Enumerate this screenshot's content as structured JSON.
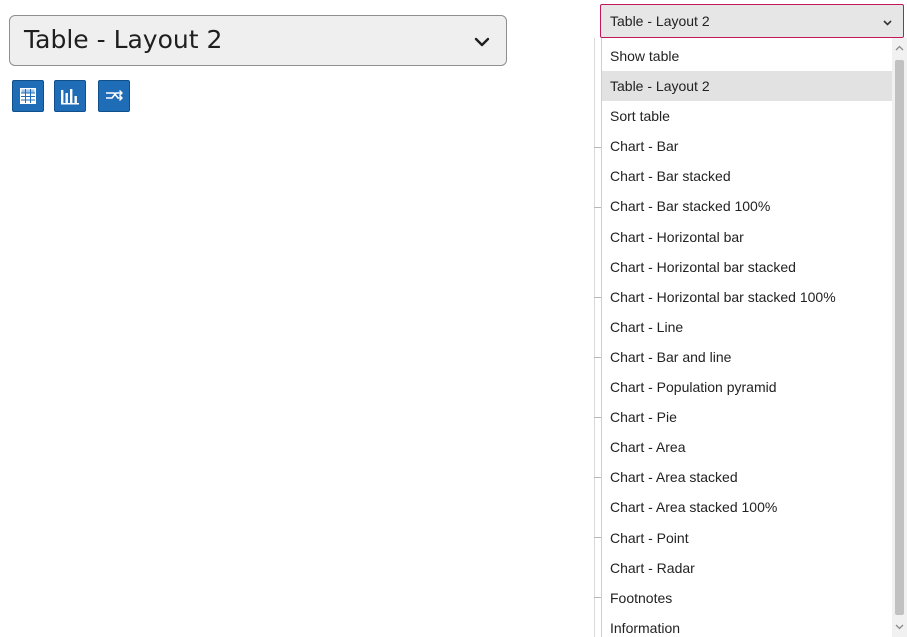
{
  "main_select": {
    "value": "Table - Layout 2"
  },
  "view_buttons": [
    {
      "icon": "table-icon"
    },
    {
      "icon": "bar-chart-icon"
    },
    {
      "icon": "pivot-icon"
    }
  ],
  "dropdown_select": {
    "value": "Table - Layout 2"
  },
  "dropdown": {
    "selected": "Table - Layout 2",
    "items": [
      "Show table",
      "Table - Layout 2",
      "Sort table",
      "Chart - Bar",
      "Chart - Bar stacked",
      "Chart - Bar stacked 100%",
      "Chart - Horizontal bar",
      "Chart - Horizontal bar stacked",
      "Chart - Horizontal bar stacked 100%",
      "Chart - Line",
      "Chart - Bar and line",
      "Chart - Population pyramid",
      "Chart - Pie",
      "Chart - Area",
      "Chart - Area stacked",
      "Chart - Area stacked 100%",
      "Chart - Point",
      "Chart - Radar",
      "Footnotes",
      "Information"
    ]
  },
  "colors": {
    "button_blue": "#1f6db6",
    "focus_border": "#c2185b",
    "selected_bg": "#e2e2e2"
  }
}
